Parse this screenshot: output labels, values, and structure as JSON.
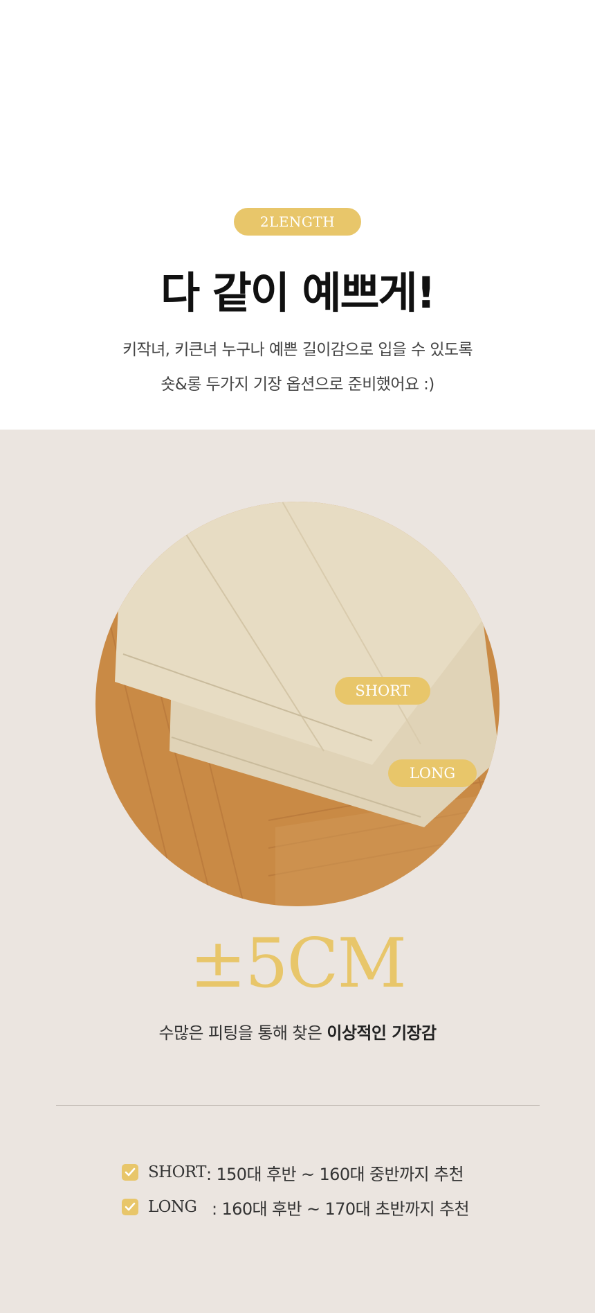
{
  "header": {
    "badge": "2LENGTH",
    "headline": "다 같이 예쁘게!",
    "desc_line1": "키작녀, 키큰녀 누구나 예쁜 길이감으로 입을 수 있도록",
    "desc_line2": "숏&롱 두가지 기장 옵션으로 준비했어요 :)"
  },
  "photo": {
    "tag_short": "SHORT",
    "tag_long": "LONG"
  },
  "measure": {
    "value": "±5CM",
    "sub_plain": "수많은 피팅을 통해 찾은 ",
    "sub_bold": "이상적인 기장감"
  },
  "options": [
    {
      "key": "SHORT",
      "desc": " : 150대 후반 ~ 160대 중반까지 추천"
    },
    {
      "key": "LONG",
      "desc": " : 160대 후반 ~ 170대 초반까지 추천"
    }
  ],
  "colors": {
    "accent": "#e8c66a",
    "background_lower": "#ebe5e0",
    "fabric": "#ddd0b4",
    "wood": "#c98a45"
  },
  "icons": [
    "check-icon"
  ]
}
